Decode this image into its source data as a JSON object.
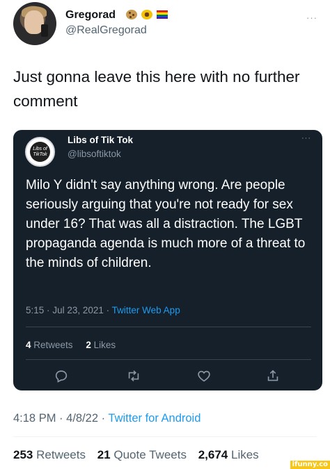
{
  "author": {
    "display_name": "Gregorad",
    "emojis": [
      "cookie-emoji",
      "sunflower-emoji",
      "rainbow-flag-emoji"
    ],
    "handle": "@RealGregorad"
  },
  "tweet": {
    "text": "Just gonna leave this here with no further comment",
    "time": "4:18 PM",
    "date": "4/8/22",
    "app": "Twitter for Android",
    "stats": {
      "retweets_count": "253",
      "retweets_label": "Retweets",
      "quotes_count": "21",
      "quotes_label": "Quote Tweets",
      "likes_count": "2,674",
      "likes_label": "Likes"
    }
  },
  "quoted": {
    "display_name": "Libs of Tik Tok",
    "handle": "@libsoftiktok",
    "avatar_text": "Libs of TikTok",
    "text": "Milo Y didn't say anything wrong. Are people seriously arguing that you're not ready for sex under 16? That was all a distraction. The LGBT propaganda agenda is much more of a threat to the minds of children.",
    "time": "5:15",
    "date": "Jul 23, 2021",
    "app": "Twitter Web App",
    "stats": {
      "retweets_count": "4",
      "retweets_label": "Retweets",
      "likes_count": "2",
      "likes_label": "Likes"
    },
    "theme": {
      "background": "#15202b",
      "accent": "#1d9bf0"
    }
  },
  "watermark": "ifunny.co",
  "separator": "·",
  "more_glyph": "···"
}
